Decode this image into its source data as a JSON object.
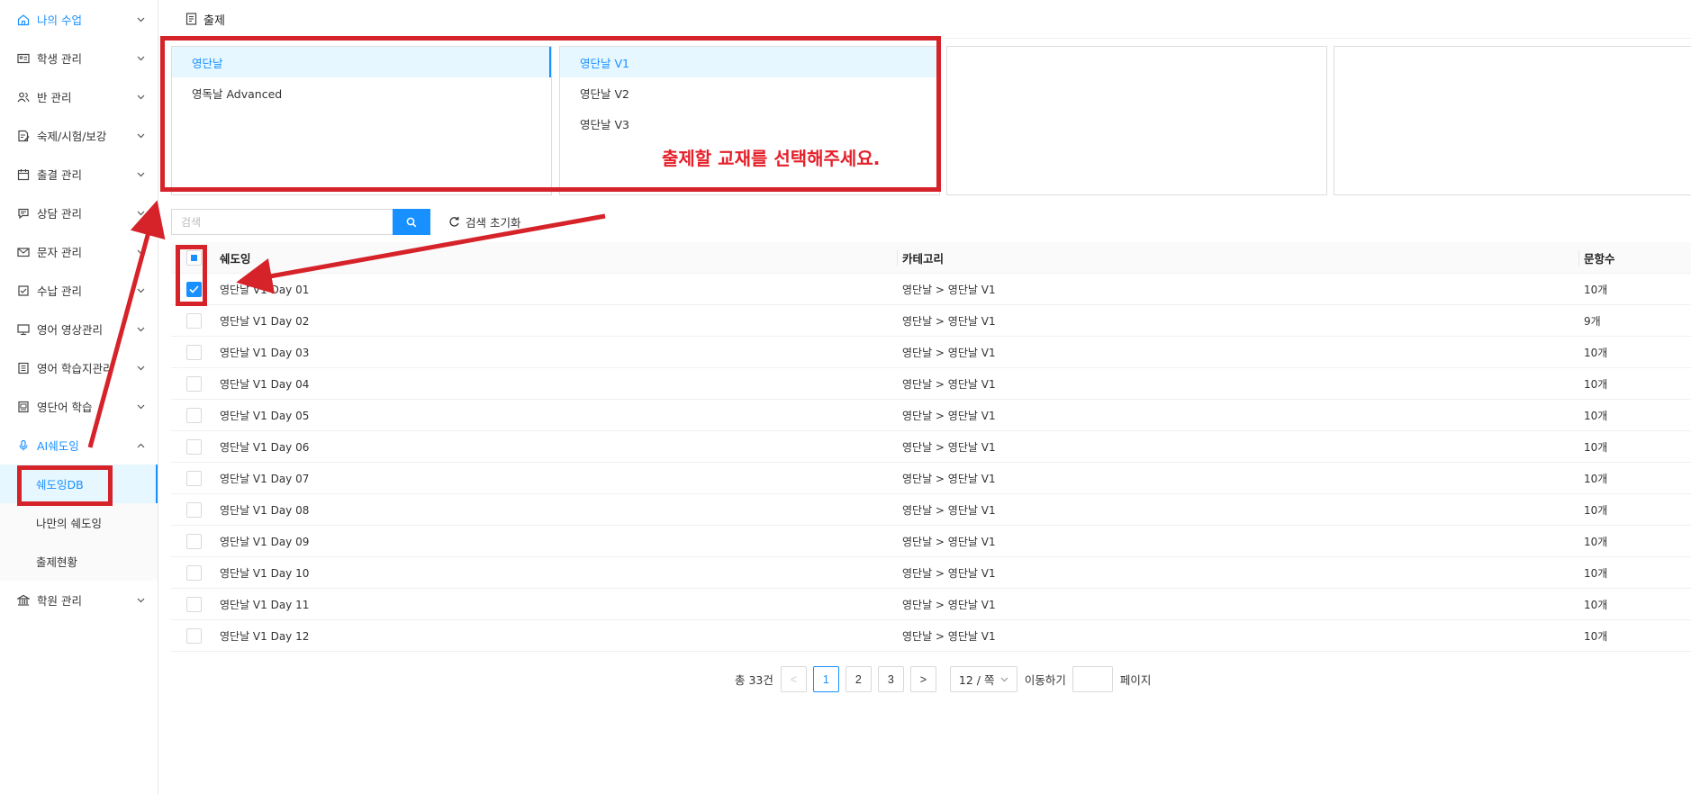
{
  "sidebar": {
    "items": [
      {
        "label": "나의 수업",
        "icon": "home-icon",
        "active": true
      },
      {
        "label": "학생 관리",
        "icon": "id-card-icon"
      },
      {
        "label": "반 관리",
        "icon": "users-icon"
      },
      {
        "label": "숙제/시험/보강",
        "icon": "document-edit-icon"
      },
      {
        "label": "출결 관리",
        "icon": "calendar-icon"
      },
      {
        "label": "상담 관리",
        "icon": "chat-icon"
      },
      {
        "label": "문자 관리",
        "icon": "mail-icon"
      },
      {
        "label": "수납 관리",
        "icon": "receipt-icon"
      },
      {
        "label": "영어 영상관리",
        "icon": "monitor-icon"
      },
      {
        "label": "영어 학습지관리",
        "icon": "worksheet-icon"
      },
      {
        "label": "영단어 학습",
        "icon": "book-icon"
      },
      {
        "label": "AI쉐도잉",
        "icon": "microphone-icon",
        "active": true,
        "expanded": true
      }
    ],
    "ai_submenu": [
      {
        "label": "쉐도잉DB",
        "selected": true
      },
      {
        "label": "나만의 쉐도잉"
      },
      {
        "label": "출제현황"
      }
    ],
    "last_item": {
      "label": "학원 관리",
      "icon": "building-icon"
    }
  },
  "topbar": {
    "title": "출제",
    "icon": "document-icon"
  },
  "panels": {
    "p1": [
      {
        "label": "영단날",
        "selected": true
      },
      {
        "label": "영독날 Advanced"
      }
    ],
    "p2": [
      {
        "label": "영단날 V1",
        "selected": true
      },
      {
        "label": "영단날 V2"
      },
      {
        "label": "영단날 V3"
      }
    ]
  },
  "instruction": "출제할 교재를 선택해주세요.",
  "search": {
    "placeholder": "검색",
    "reset_label": "검색 초기화"
  },
  "table": {
    "columns": [
      "쉐도잉",
      "카테고리",
      "문항수"
    ],
    "rows": [
      {
        "name": "영단날 V1 Day 01",
        "category": "영단날 > 영단날 V1",
        "count": "10개",
        "checked": true
      },
      {
        "name": "영단날 V1 Day 02",
        "category": "영단날 > 영단날 V1",
        "count": "9개"
      },
      {
        "name": "영단날 V1 Day 03",
        "category": "영단날 > 영단날 V1",
        "count": "10개"
      },
      {
        "name": "영단날 V1 Day 04",
        "category": "영단날 > 영단날 V1",
        "count": "10개"
      },
      {
        "name": "영단날 V1 Day 05",
        "category": "영단날 > 영단날 V1",
        "count": "10개"
      },
      {
        "name": "영단날 V1 Day 06",
        "category": "영단날 > 영단날 V1",
        "count": "10개"
      },
      {
        "name": "영단날 V1 Day 07",
        "category": "영단날 > 영단날 V1",
        "count": "10개"
      },
      {
        "name": "영단날 V1 Day 08",
        "category": "영단날 > 영단날 V1",
        "count": "10개"
      },
      {
        "name": "영단날 V1 Day 09",
        "category": "영단날 > 영단날 V1",
        "count": "10개"
      },
      {
        "name": "영단날 V1 Day 10",
        "category": "영단날 > 영단날 V1",
        "count": "10개"
      },
      {
        "name": "영단날 V1 Day 11",
        "category": "영단날 > 영단날 V1",
        "count": "10개"
      },
      {
        "name": "영단날 V1 Day 12",
        "category": "영단날 > 영단날 V1",
        "count": "10개"
      }
    ]
  },
  "pagination": {
    "total": "총 33건",
    "pages": [
      "1",
      "2",
      "3"
    ],
    "current": "1",
    "prev": "<",
    "next": ">",
    "page_size": "12 / 쪽",
    "jump_label": "이동하기",
    "jump_suffix": "페이지"
  },
  "colors": {
    "accent": "#1890ff",
    "annotation_red": "#d6232a"
  }
}
